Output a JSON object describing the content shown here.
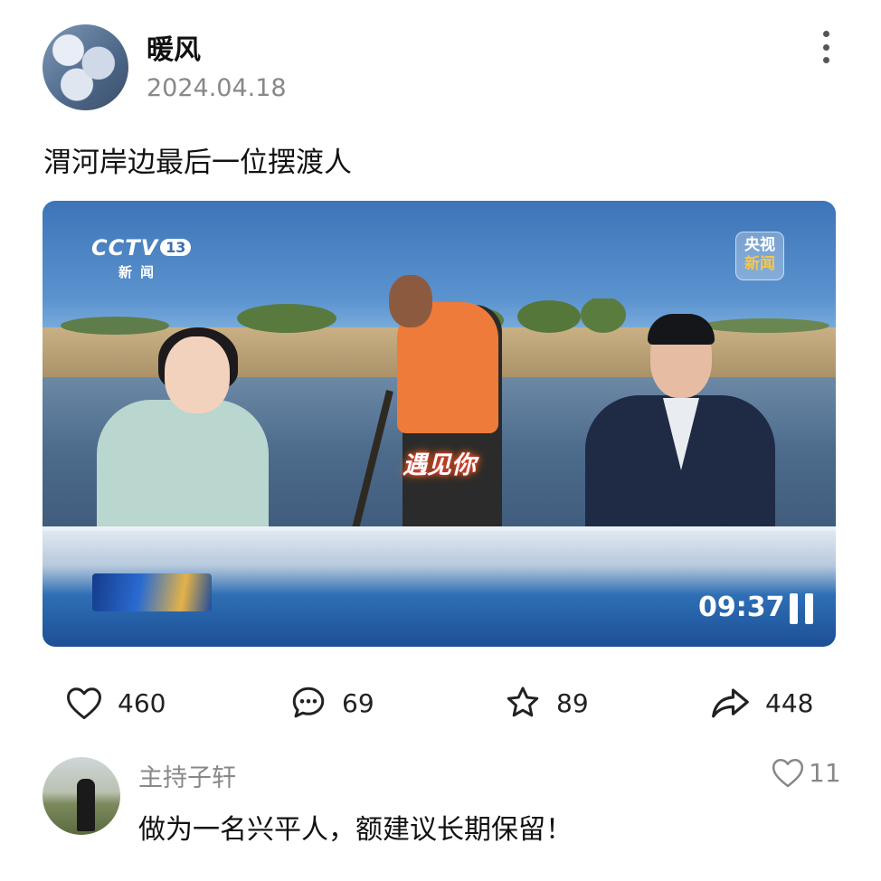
{
  "post": {
    "author": "暖风",
    "date": "2024.04.18",
    "title": "渭河岸边最后一位摆渡人"
  },
  "video": {
    "channel_logo": "CCTV",
    "channel_number": "13",
    "channel_sub": "新闻",
    "badge_top": "央视",
    "badge_bottom": "新闻",
    "caption": "遇见你",
    "duration": "09:37"
  },
  "actions": {
    "likes": "460",
    "comments": "69",
    "favorites": "89",
    "shares": "448"
  },
  "comment": {
    "author": "主持子轩",
    "text": "做为一名兴平人，额建议长期保留！",
    "likes": "11"
  }
}
